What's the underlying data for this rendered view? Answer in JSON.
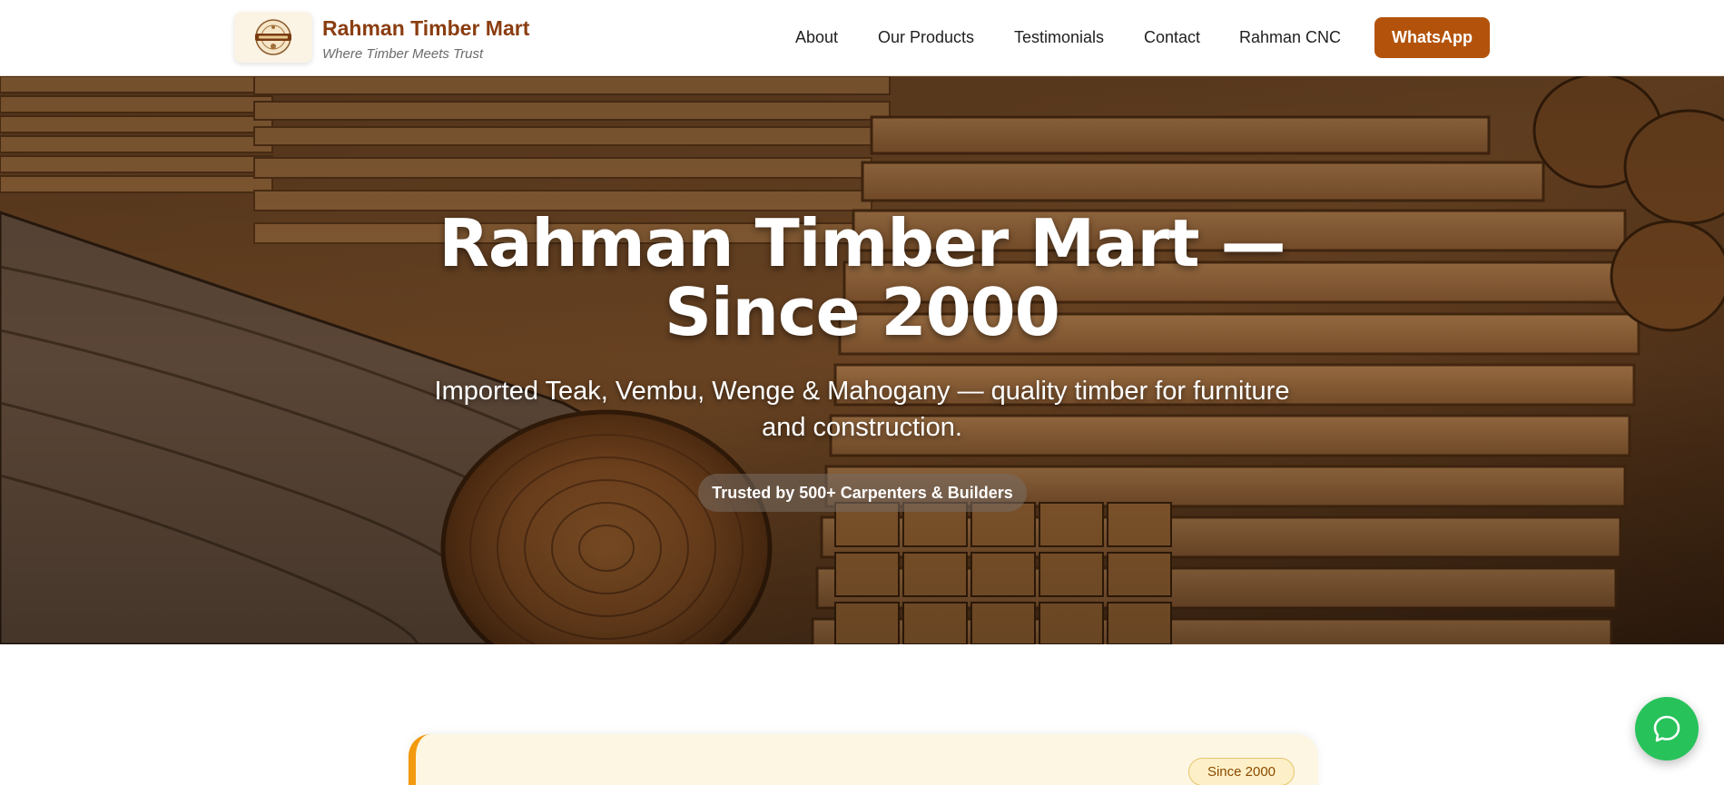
{
  "header": {
    "brand_name": "Rahman Timber Mart",
    "tagline": "Where Timber Meets Trust",
    "logo_icon": "timber-seal-logo",
    "nav": [
      {
        "label": "About"
      },
      {
        "label": "Our Products"
      },
      {
        "label": "Testimonials"
      },
      {
        "label": "Contact"
      },
      {
        "label": "Rahman CNC"
      }
    ],
    "cta_label": "WhatsApp"
  },
  "hero": {
    "title_line1": "Rahman Timber Mart —",
    "title_line2": "Since 2000",
    "subtitle_line1": "Imported Teak, Vembu, Wenge & Mahogany — quality timber for furniture",
    "subtitle_line2": "and construction.",
    "badge": "Trusted by 500+ Carpenters & Builders"
  },
  "card": {
    "since_label": "Since 2000"
  },
  "chat_fab": {
    "icon": "chat-bubble-icon"
  },
  "colors": {
    "brand": "#8a3d10",
    "cta": "#b3530b",
    "accent": "#f29a10",
    "chat": "#27c25a"
  }
}
